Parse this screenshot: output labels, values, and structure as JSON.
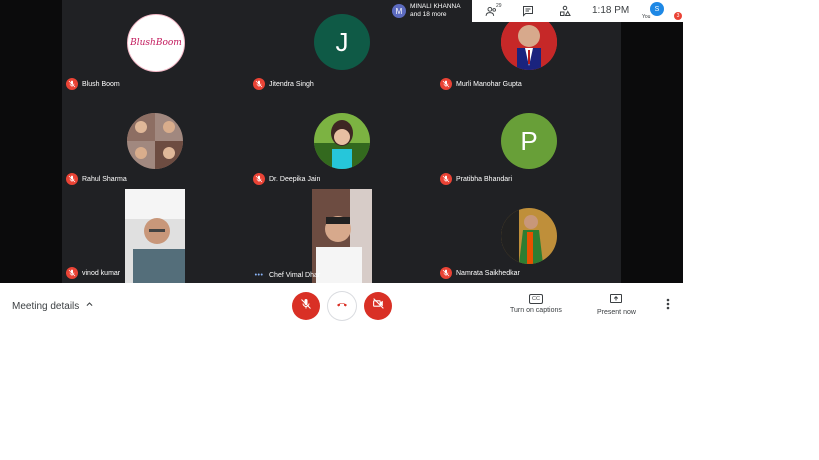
{
  "presenter": {
    "avatar_letter": "M",
    "name": "MINALI KHANNA",
    "subtitle": "and 18 more"
  },
  "topbar": {
    "people_count": "29",
    "time": "1:18 PM",
    "user_initial": "S",
    "user_label": "You",
    "notification_badge": "3"
  },
  "participants": [
    {
      "name": "Blush Boom",
      "muted": true,
      "avatar_text": "BlushBoom",
      "kind": "logo"
    },
    {
      "name": "Jitendra Singh",
      "muted": true,
      "avatar_text": "J",
      "kind": "letter",
      "color": "#0f5a46"
    },
    {
      "name": "Murli Manohar Gupta",
      "muted": true,
      "kind": "photo",
      "color": "#c62828"
    },
    {
      "name": "Rahul Sharma",
      "muted": true,
      "kind": "photo",
      "color": "#8d6e63"
    },
    {
      "name": "Dr. Deepika Jain",
      "muted": true,
      "kind": "photo",
      "color": "#7cb342"
    },
    {
      "name": "Pratibha Bhandari",
      "muted": true,
      "avatar_text": "P",
      "kind": "letter",
      "color": "#689f38"
    },
    {
      "name": "vinod kumar",
      "muted": true,
      "kind": "video",
      "color": "#9e9e9e"
    },
    {
      "name": "Chef Vimal Dhar",
      "muted": false,
      "speaking_indicator": "•••",
      "kind": "video",
      "color": "#5d4037"
    },
    {
      "name": "Namrata Saikhedkar",
      "muted": true,
      "kind": "photo",
      "color": "#bf8f3a"
    }
  ],
  "bottombar": {
    "meeting_details": "Meeting details",
    "captions_label": "Turn on captions",
    "captions_icon_text": "CC",
    "present_label": "Present now"
  },
  "colors": {
    "danger": "#d93025",
    "stage": "#202124"
  }
}
